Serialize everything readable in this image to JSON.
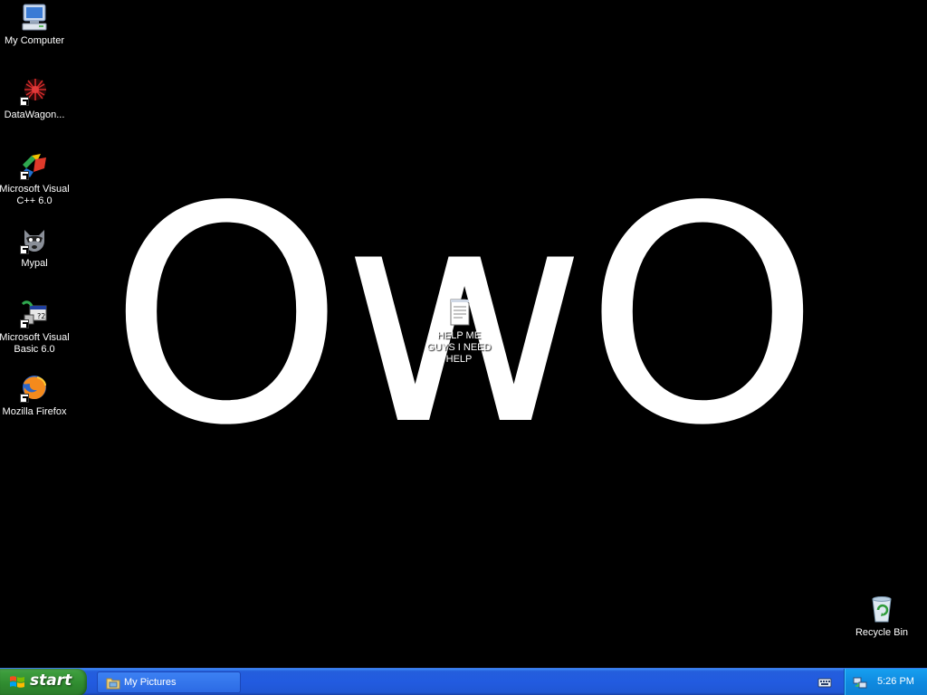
{
  "desktop": {
    "wallpaper_text": "OwO",
    "background_color": "#000000",
    "icons": [
      {
        "label": "My Computer",
        "icon": "computer-icon"
      },
      {
        "label": "DataWagon...",
        "icon": "datawagon-icon"
      },
      {
        "label": "Microsoft Visual C++ 6.0",
        "icon": "visual-cpp-icon"
      },
      {
        "label": "Mypal",
        "icon": "mypal-icon"
      },
      {
        "label": "Microsoft Visual Basic 6.0",
        "icon": "visual-basic-icon"
      },
      {
        "label": "Mozilla Firefox",
        "icon": "firefox-icon"
      },
      {
        "label": "HELP ME GUYS I NEED HELP",
        "icon": "text-document-icon"
      },
      {
        "label": "Recycle Bin",
        "icon": "recycle-bin-icon"
      }
    ]
  },
  "taskbar": {
    "start_label": "start",
    "tasks": [
      {
        "label": "My Pictures",
        "icon": "folder-icon"
      }
    ],
    "tray": {
      "time": "5:26 PM",
      "icons": [
        "keyboard-language-icon",
        "network-icon"
      ]
    },
    "colors": {
      "taskbar_blue": "#245edc",
      "start_green": "#3c9c3c",
      "tray_blue": "#0f8ae0"
    }
  }
}
